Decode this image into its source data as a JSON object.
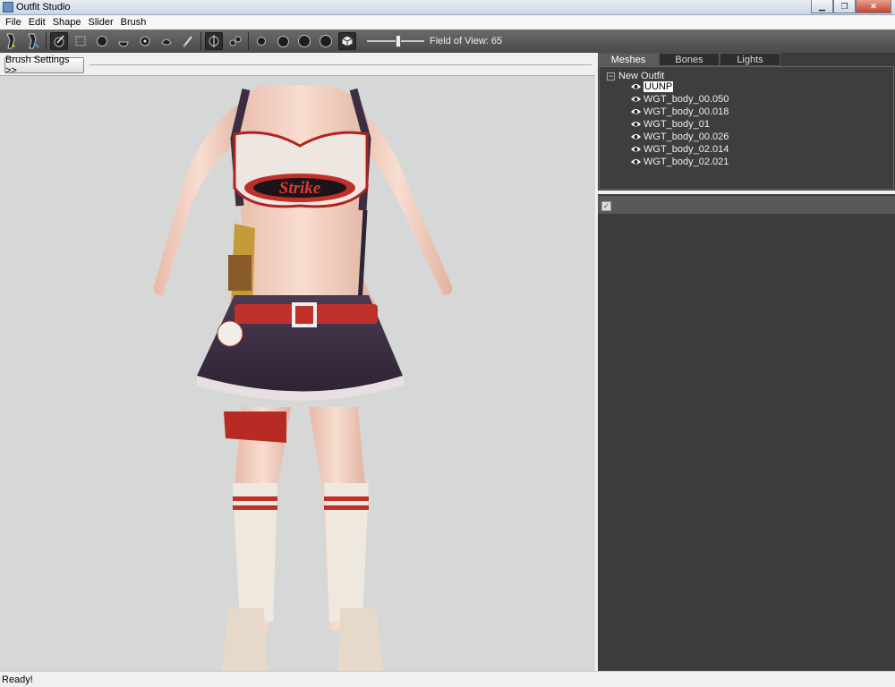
{
  "window": {
    "title": "Outfit Studio"
  },
  "menu": [
    "File",
    "Edit",
    "Shape",
    "Slider",
    "Brush"
  ],
  "toolbar": {
    "fov_label": "Field of View: 65",
    "fov_value": 65
  },
  "viewport": {
    "brush_settings_label": "Brush Settings >>"
  },
  "tabs": [
    "Meshes",
    "Bones",
    "Lights"
  ],
  "tree": {
    "root": "New Outfit",
    "items": [
      "UUNP",
      "WGT_body_00.050",
      "WGT_body_00.018",
      "WGT_body_01",
      "WGT_body_00.026",
      "WGT_body_02.014",
      "WGT_body_02.021"
    ]
  },
  "status": {
    "text": "Ready!"
  },
  "colors": {
    "toolbar": "#555555",
    "panel": "#3c3c3c",
    "viewport": "#d5d8d6",
    "accent_red": "#c0302a"
  }
}
